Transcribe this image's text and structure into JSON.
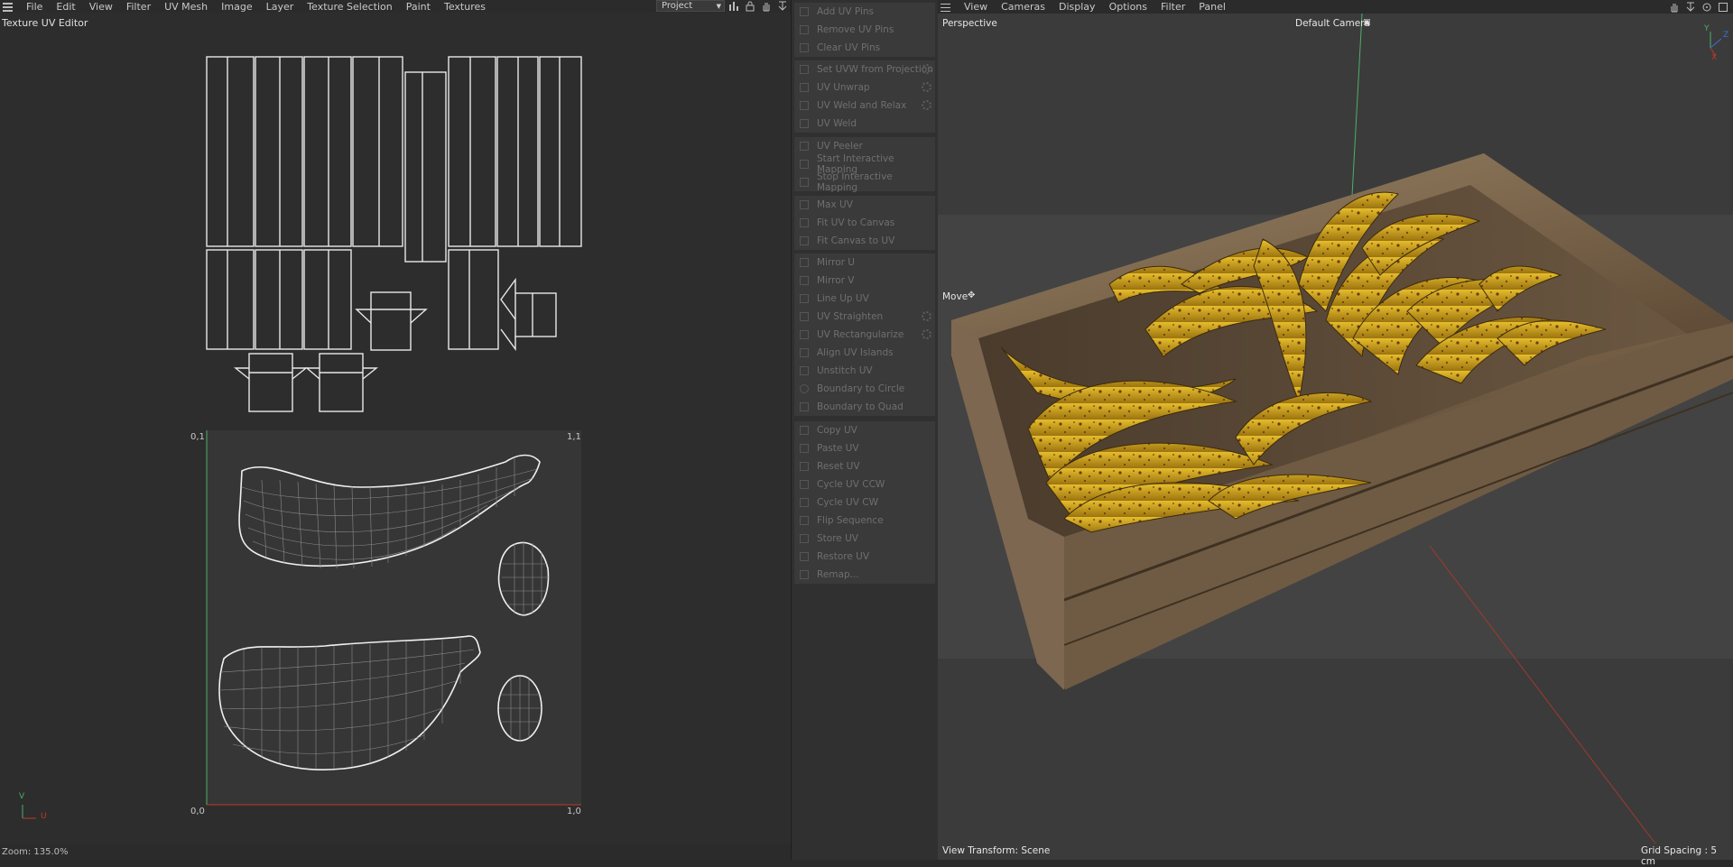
{
  "uv_editor": {
    "menu": [
      "File",
      "Edit",
      "View",
      "Filter",
      "UV Mesh",
      "Image",
      "Layer",
      "Texture Selection",
      "Paint",
      "Textures"
    ],
    "project_select": "Project",
    "title": "Texture UV Editor",
    "zoom": "Zoom: 135.0%",
    "corners": {
      "top_left": "0,1",
      "top_right": "1,1",
      "bottom_left": "0,0",
      "bottom_right": "1,0"
    },
    "axis_v": "V",
    "axis_u": "U"
  },
  "commands": {
    "groups": [
      [
        "Add UV Pins",
        "Remove UV Pins",
        "Clear UV Pins"
      ],
      [
        "Set UVW from Projection",
        "UV Unwrap",
        "UV Weld and Relax",
        "UV Weld"
      ],
      [
        "UV Peeler",
        "Start Interactive Mapping",
        "Stop Interactive Mapping"
      ],
      [
        "Max UV",
        "Fit UV to Canvas",
        "Fit Canvas to UV"
      ],
      [
        "Mirror U",
        "Mirror V",
        "Line Up UV",
        "UV Straighten",
        "UV Rectangularize",
        "Align UV Islands",
        "Unstitch UV",
        "Boundary to Circle",
        "Boundary to Quad"
      ],
      [
        "Copy UV",
        "Paste UV",
        "Reset UV",
        "Cycle UV CCW",
        "Cycle UV CW",
        "Flip Sequence",
        "Store UV",
        "Restore UV",
        "Remap..."
      ]
    ]
  },
  "viewport": {
    "menu": [
      "View",
      "Cameras",
      "Display",
      "Options",
      "Filter",
      "Panel"
    ],
    "projection": "Perspective",
    "camera": "Default Camera",
    "tool": "Move",
    "view_transform": "View Transform: Scene",
    "grid_spacing": "Grid Spacing : 5 cm",
    "axes": {
      "x": "X",
      "y": "Y",
      "z": "Z"
    }
  },
  "colors": {
    "accent_green": "#4caf6a",
    "accent_red": "#c0392b",
    "banana": "#d6a91c",
    "crate": "#8a7254"
  }
}
